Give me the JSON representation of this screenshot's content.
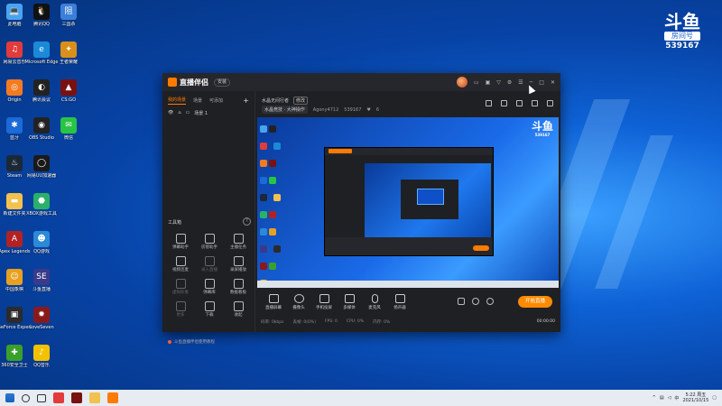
{
  "desktop_icons": [
    {
      "label": "此电脑",
      "color": "#4aa3f0",
      "glyph": "💻"
    },
    {
      "label": "腾讯QQ",
      "color": "#111111",
      "glyph": "🐧"
    },
    {
      "label": "三国杀",
      "color": "#3b7fd8",
      "glyph": "阻"
    },
    {
      "label": "网易云音乐",
      "color": "#e23b3b",
      "glyph": "♫"
    },
    {
      "label": "Microsoft Edge",
      "color": "#1a8ad8",
      "glyph": "e"
    },
    {
      "label": "王者荣耀",
      "color": "#d8901a",
      "glyph": "✦"
    },
    {
      "label": "Origin",
      "color": "#f47a20",
      "glyph": "◎"
    },
    {
      "label": "腾讯会议",
      "color": "#222222",
      "glyph": "◐"
    },
    {
      "label": "CS:GO",
      "color": "#7a1010",
      "glyph": "▲"
    },
    {
      "label": "蓝牙",
      "color": "#1a6ad8",
      "glyph": "✱"
    },
    {
      "label": "OBS Studio",
      "color": "#222222",
      "glyph": "◉"
    },
    {
      "label": "微信",
      "color": "#28c445",
      "glyph": "✉"
    },
    {
      "label": "Steam",
      "color": "#1b2838",
      "glyph": "♨"
    },
    {
      "label": "网易UU加速器",
      "color": "#1a1a1a",
      "glyph": "◯"
    },
    {
      "label": "",
      "color": "",
      "glyph": ""
    },
    {
      "label": "新建文件夹",
      "color": "#f2c14e",
      "glyph": "▬"
    },
    {
      "label": "XBOX游戏工具",
      "color": "#2ab06a",
      "glyph": "⬣"
    },
    {
      "label": "",
      "color": "",
      "glyph": ""
    },
    {
      "label": "Apex Legends",
      "color": "#b22222",
      "glyph": "A"
    },
    {
      "label": "QQ游戏",
      "color": "#2a8ad8",
      "glyph": "☻"
    },
    {
      "label": "",
      "color": "",
      "glyph": ""
    },
    {
      "label": "中国象棋",
      "color": "#e8a020",
      "glyph": "☺"
    },
    {
      "label": "斗鱼直播",
      "color": "#3a3a8a",
      "glyph": "SE"
    },
    {
      "label": "",
      "color": "",
      "glyph": ""
    },
    {
      "label": "GeForce Experience",
      "color": "#2b2b2b",
      "glyph": "▣"
    },
    {
      "label": "LoveSeven",
      "color": "#8a1a1a",
      "glyph": "✹"
    },
    {
      "label": "",
      "color": "",
      "glyph": ""
    },
    {
      "label": "360安全卫士",
      "color": "#3aa02a",
      "glyph": "✚"
    },
    {
      "label": "QQ音乐",
      "color": "#f2c200",
      "glyph": "♪"
    }
  ],
  "watermark": {
    "logo": "斗鱼",
    "tag": "房间号",
    "room": "539167"
  },
  "app": {
    "title": "直播伴侣",
    "version": "安装",
    "left_tabs": [
      "我的场景",
      "场景",
      "可添加",
      "+"
    ],
    "scene_name": "场景 1",
    "tool_section": "工具箱",
    "help_label": "?",
    "tools": [
      {
        "label": "弹幕助手",
        "dim": false
      },
      {
        "label": "房管助手",
        "dim": false
      },
      {
        "label": "主播任务",
        "dim": false
      },
      {
        "label": "视频连麦",
        "dim": false
      },
      {
        "label": "录入直播",
        "dim": true
      },
      {
        "label": "录屏播放",
        "dim": false
      },
      {
        "label": "虚拟形象",
        "dim": true
      },
      {
        "label": "弹幕库",
        "dim": false
      },
      {
        "label": "数据看板",
        "dim": false
      },
      {
        "label": "更多",
        "dim": true
      },
      {
        "label": "下载",
        "dim": false
      },
      {
        "label": "收起",
        "dim": false
      }
    ],
    "notice": "斗鱼直播伴侣使用教程",
    "room_title": "水晶无间行者",
    "room_edit": "修改",
    "room_category": "水晶竞技 · 大神操作",
    "room_owner": "Agony4712",
    "room_id": "539167",
    "room_fans": "6",
    "controls": [
      "直播屏幕",
      "摄像头",
      "手机投屏",
      "多媒体",
      "麦克风",
      "扬声器"
    ],
    "live_button": "开始直播",
    "stats": [
      "码率: 0kbps",
      "丢帧: 0(0%)",
      "FPS: 0",
      "CPU: 0%",
      "内存: 0%"
    ],
    "timer": "00:00:00"
  },
  "taskbar": {
    "time": "5:22 周五",
    "date": "2021/10/15"
  }
}
